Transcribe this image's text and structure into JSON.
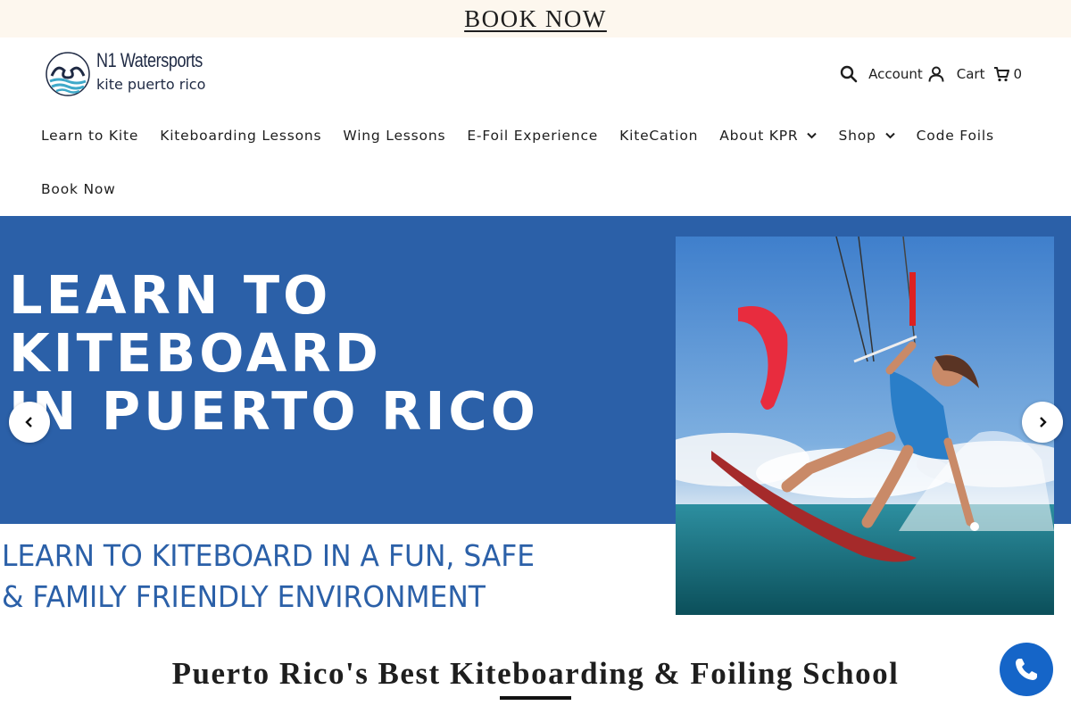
{
  "announcement": {
    "link_label": "BOOK NOW"
  },
  "logo": {
    "brand": "N1 Watersports",
    "sub": "kite puerto rico"
  },
  "header": {
    "search_icon": "search-icon",
    "account_label": "Account",
    "cart_label": "Cart",
    "cart_count": "0"
  },
  "nav": {
    "items": [
      {
        "label": "Learn to Kite"
      },
      {
        "label": "Kiteboarding Lessons"
      },
      {
        "label": "Wing Lessons"
      },
      {
        "label": "E-Foil Experience"
      },
      {
        "label": "KiteCation"
      },
      {
        "label": "About KPR"
      },
      {
        "label": "Shop"
      },
      {
        "label": "Code Foils"
      },
      {
        "label": "Book Now"
      }
    ]
  },
  "hero": {
    "headline_lines": [
      "LEARN TO",
      "KITEBOARD",
      "IN PUERTO RICO"
    ],
    "tagline_lines": [
      "LEARN TO KITEBOARD IN A FUN, SAFE",
      "& FAMILY FRIENDLY ENVIRONMENT"
    ],
    "colors": {
      "brand_blue": "#2b60a8",
      "phone_blue": "#1565c8"
    }
  },
  "section": {
    "title": "Puerto Rico's Best Kiteboarding & Foiling School"
  }
}
